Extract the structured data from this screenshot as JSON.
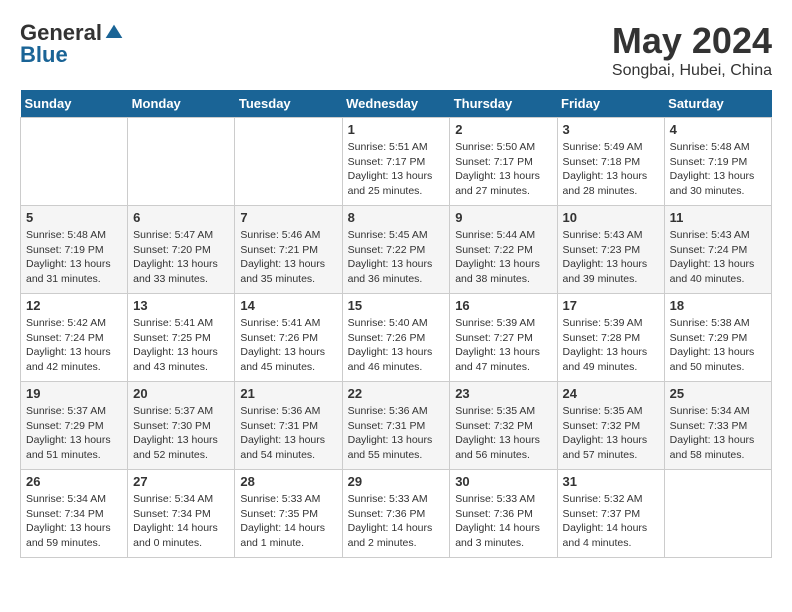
{
  "header": {
    "logo_general": "General",
    "logo_blue": "Blue",
    "title": "May 2024",
    "location": "Songbai, Hubei, China"
  },
  "days_of_week": [
    "Sunday",
    "Monday",
    "Tuesday",
    "Wednesday",
    "Thursday",
    "Friday",
    "Saturday"
  ],
  "weeks": [
    {
      "days": [
        {
          "number": "",
          "info": ""
        },
        {
          "number": "",
          "info": ""
        },
        {
          "number": "",
          "info": ""
        },
        {
          "number": "1",
          "info": "Sunrise: 5:51 AM\nSunset: 7:17 PM\nDaylight: 13 hours\nand 25 minutes."
        },
        {
          "number": "2",
          "info": "Sunrise: 5:50 AM\nSunset: 7:17 PM\nDaylight: 13 hours\nand 27 minutes."
        },
        {
          "number": "3",
          "info": "Sunrise: 5:49 AM\nSunset: 7:18 PM\nDaylight: 13 hours\nand 28 minutes."
        },
        {
          "number": "4",
          "info": "Sunrise: 5:48 AM\nSunset: 7:19 PM\nDaylight: 13 hours\nand 30 minutes."
        }
      ]
    },
    {
      "days": [
        {
          "number": "5",
          "info": "Sunrise: 5:48 AM\nSunset: 7:19 PM\nDaylight: 13 hours\nand 31 minutes."
        },
        {
          "number": "6",
          "info": "Sunrise: 5:47 AM\nSunset: 7:20 PM\nDaylight: 13 hours\nand 33 minutes."
        },
        {
          "number": "7",
          "info": "Sunrise: 5:46 AM\nSunset: 7:21 PM\nDaylight: 13 hours\nand 35 minutes."
        },
        {
          "number": "8",
          "info": "Sunrise: 5:45 AM\nSunset: 7:22 PM\nDaylight: 13 hours\nand 36 minutes."
        },
        {
          "number": "9",
          "info": "Sunrise: 5:44 AM\nSunset: 7:22 PM\nDaylight: 13 hours\nand 38 minutes."
        },
        {
          "number": "10",
          "info": "Sunrise: 5:43 AM\nSunset: 7:23 PM\nDaylight: 13 hours\nand 39 minutes."
        },
        {
          "number": "11",
          "info": "Sunrise: 5:43 AM\nSunset: 7:24 PM\nDaylight: 13 hours\nand 40 minutes."
        }
      ]
    },
    {
      "days": [
        {
          "number": "12",
          "info": "Sunrise: 5:42 AM\nSunset: 7:24 PM\nDaylight: 13 hours\nand 42 minutes."
        },
        {
          "number": "13",
          "info": "Sunrise: 5:41 AM\nSunset: 7:25 PM\nDaylight: 13 hours\nand 43 minutes."
        },
        {
          "number": "14",
          "info": "Sunrise: 5:41 AM\nSunset: 7:26 PM\nDaylight: 13 hours\nand 45 minutes."
        },
        {
          "number": "15",
          "info": "Sunrise: 5:40 AM\nSunset: 7:26 PM\nDaylight: 13 hours\nand 46 minutes."
        },
        {
          "number": "16",
          "info": "Sunrise: 5:39 AM\nSunset: 7:27 PM\nDaylight: 13 hours\nand 47 minutes."
        },
        {
          "number": "17",
          "info": "Sunrise: 5:39 AM\nSunset: 7:28 PM\nDaylight: 13 hours\nand 49 minutes."
        },
        {
          "number": "18",
          "info": "Sunrise: 5:38 AM\nSunset: 7:29 PM\nDaylight: 13 hours\nand 50 minutes."
        }
      ]
    },
    {
      "days": [
        {
          "number": "19",
          "info": "Sunrise: 5:37 AM\nSunset: 7:29 PM\nDaylight: 13 hours\nand 51 minutes."
        },
        {
          "number": "20",
          "info": "Sunrise: 5:37 AM\nSunset: 7:30 PM\nDaylight: 13 hours\nand 52 minutes."
        },
        {
          "number": "21",
          "info": "Sunrise: 5:36 AM\nSunset: 7:31 PM\nDaylight: 13 hours\nand 54 minutes."
        },
        {
          "number": "22",
          "info": "Sunrise: 5:36 AM\nSunset: 7:31 PM\nDaylight: 13 hours\nand 55 minutes."
        },
        {
          "number": "23",
          "info": "Sunrise: 5:35 AM\nSunset: 7:32 PM\nDaylight: 13 hours\nand 56 minutes."
        },
        {
          "number": "24",
          "info": "Sunrise: 5:35 AM\nSunset: 7:32 PM\nDaylight: 13 hours\nand 57 minutes."
        },
        {
          "number": "25",
          "info": "Sunrise: 5:34 AM\nSunset: 7:33 PM\nDaylight: 13 hours\nand 58 minutes."
        }
      ]
    },
    {
      "days": [
        {
          "number": "26",
          "info": "Sunrise: 5:34 AM\nSunset: 7:34 PM\nDaylight: 13 hours\nand 59 minutes."
        },
        {
          "number": "27",
          "info": "Sunrise: 5:34 AM\nSunset: 7:34 PM\nDaylight: 14 hours\nand 0 minutes."
        },
        {
          "number": "28",
          "info": "Sunrise: 5:33 AM\nSunset: 7:35 PM\nDaylight: 14 hours\nand 1 minute."
        },
        {
          "number": "29",
          "info": "Sunrise: 5:33 AM\nSunset: 7:36 PM\nDaylight: 14 hours\nand 2 minutes."
        },
        {
          "number": "30",
          "info": "Sunrise: 5:33 AM\nSunset: 7:36 PM\nDaylight: 14 hours\nand 3 minutes."
        },
        {
          "number": "31",
          "info": "Sunrise: 5:32 AM\nSunset: 7:37 PM\nDaylight: 14 hours\nand 4 minutes."
        },
        {
          "number": "",
          "info": ""
        }
      ]
    }
  ]
}
